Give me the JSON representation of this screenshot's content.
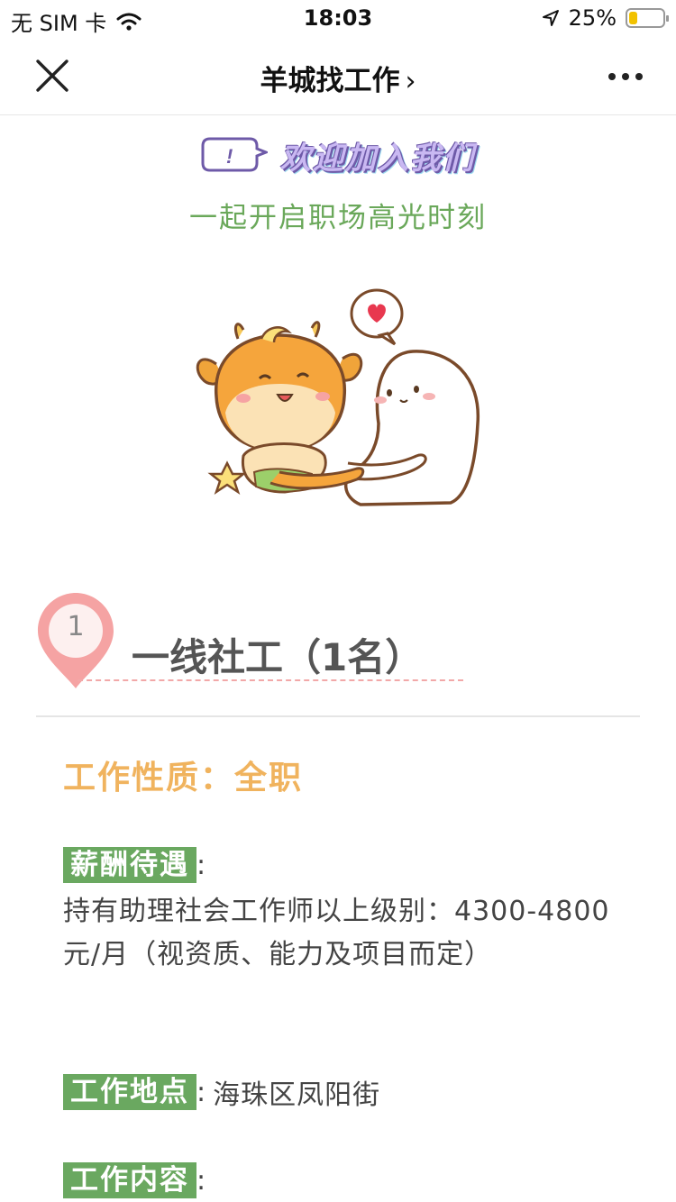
{
  "status_bar": {
    "carrier": "无 SIM 卡",
    "time": "18:03",
    "battery": "25%",
    "battery_level": 0.25
  },
  "nav": {
    "title": "羊城找工作",
    "chevron": "›"
  },
  "welcome": {
    "bubble_mark": "!",
    "title": "欢迎加入我们",
    "subtitle": "一起开启职场高光时刻"
  },
  "position": {
    "number": "1",
    "title": "一线社工（1名）",
    "job_nature": "工作性质：全职",
    "salary": {
      "label": "薪酬待遇",
      "colon": ":",
      "text": "持有助理社会工作师以上级别：4300-4800元/月（视资质、能力及项目而定）"
    },
    "location": {
      "label": "工作地点",
      "colon": ":",
      "value": "海珠区凤阳街"
    },
    "content": {
      "label": "工作内容",
      "colon": ":"
    }
  },
  "colors": {
    "label_bg": "#6aa860",
    "accent_orange": "#f0b35e",
    "pin_pink": "#f5a3a3",
    "subtitle_green": "#6aa85a"
  }
}
